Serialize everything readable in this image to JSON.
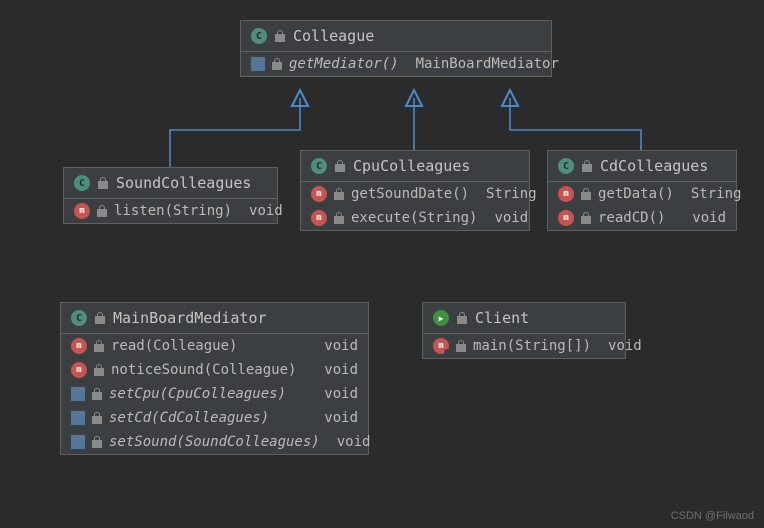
{
  "diagram": {
    "colleague": {
      "title": "Colleague",
      "method": {
        "sig": "getMediator()",
        "ret": "MainBoardMediator"
      }
    },
    "sound": {
      "title": "SoundColleagues",
      "listen": {
        "sig": "listen(String)",
        "ret": "void"
      }
    },
    "cpu": {
      "title": "CpuColleagues",
      "getSoundDate": {
        "sig": "getSoundDate()",
        "ret": "String"
      },
      "execute": {
        "sig": "execute(String)",
        "ret": "void"
      }
    },
    "cd": {
      "title": "CdColleagues",
      "getData": {
        "sig": "getData()",
        "ret": "String"
      },
      "readCD": {
        "sig": "readCD()",
        "ret": "void"
      }
    },
    "mediator": {
      "title": "MainBoardMediator",
      "read": {
        "sig": "read(Colleague)",
        "ret": "void"
      },
      "noticeSound": {
        "sig": "noticeSound(Colleague)",
        "ret": "void"
      },
      "setCpu": {
        "sig": "setCpu(CpuColleagues)",
        "ret": "void"
      },
      "setCd": {
        "sig": "setCd(CdColleagues)",
        "ret": "void"
      },
      "setSound": {
        "sig": "setSound(SoundColleagues)",
        "ret": "void"
      }
    },
    "client": {
      "title": "Client",
      "main": {
        "sig": "main(String[])",
        "ret": "void"
      }
    }
  },
  "watermark": "CSDN @Filwaod"
}
